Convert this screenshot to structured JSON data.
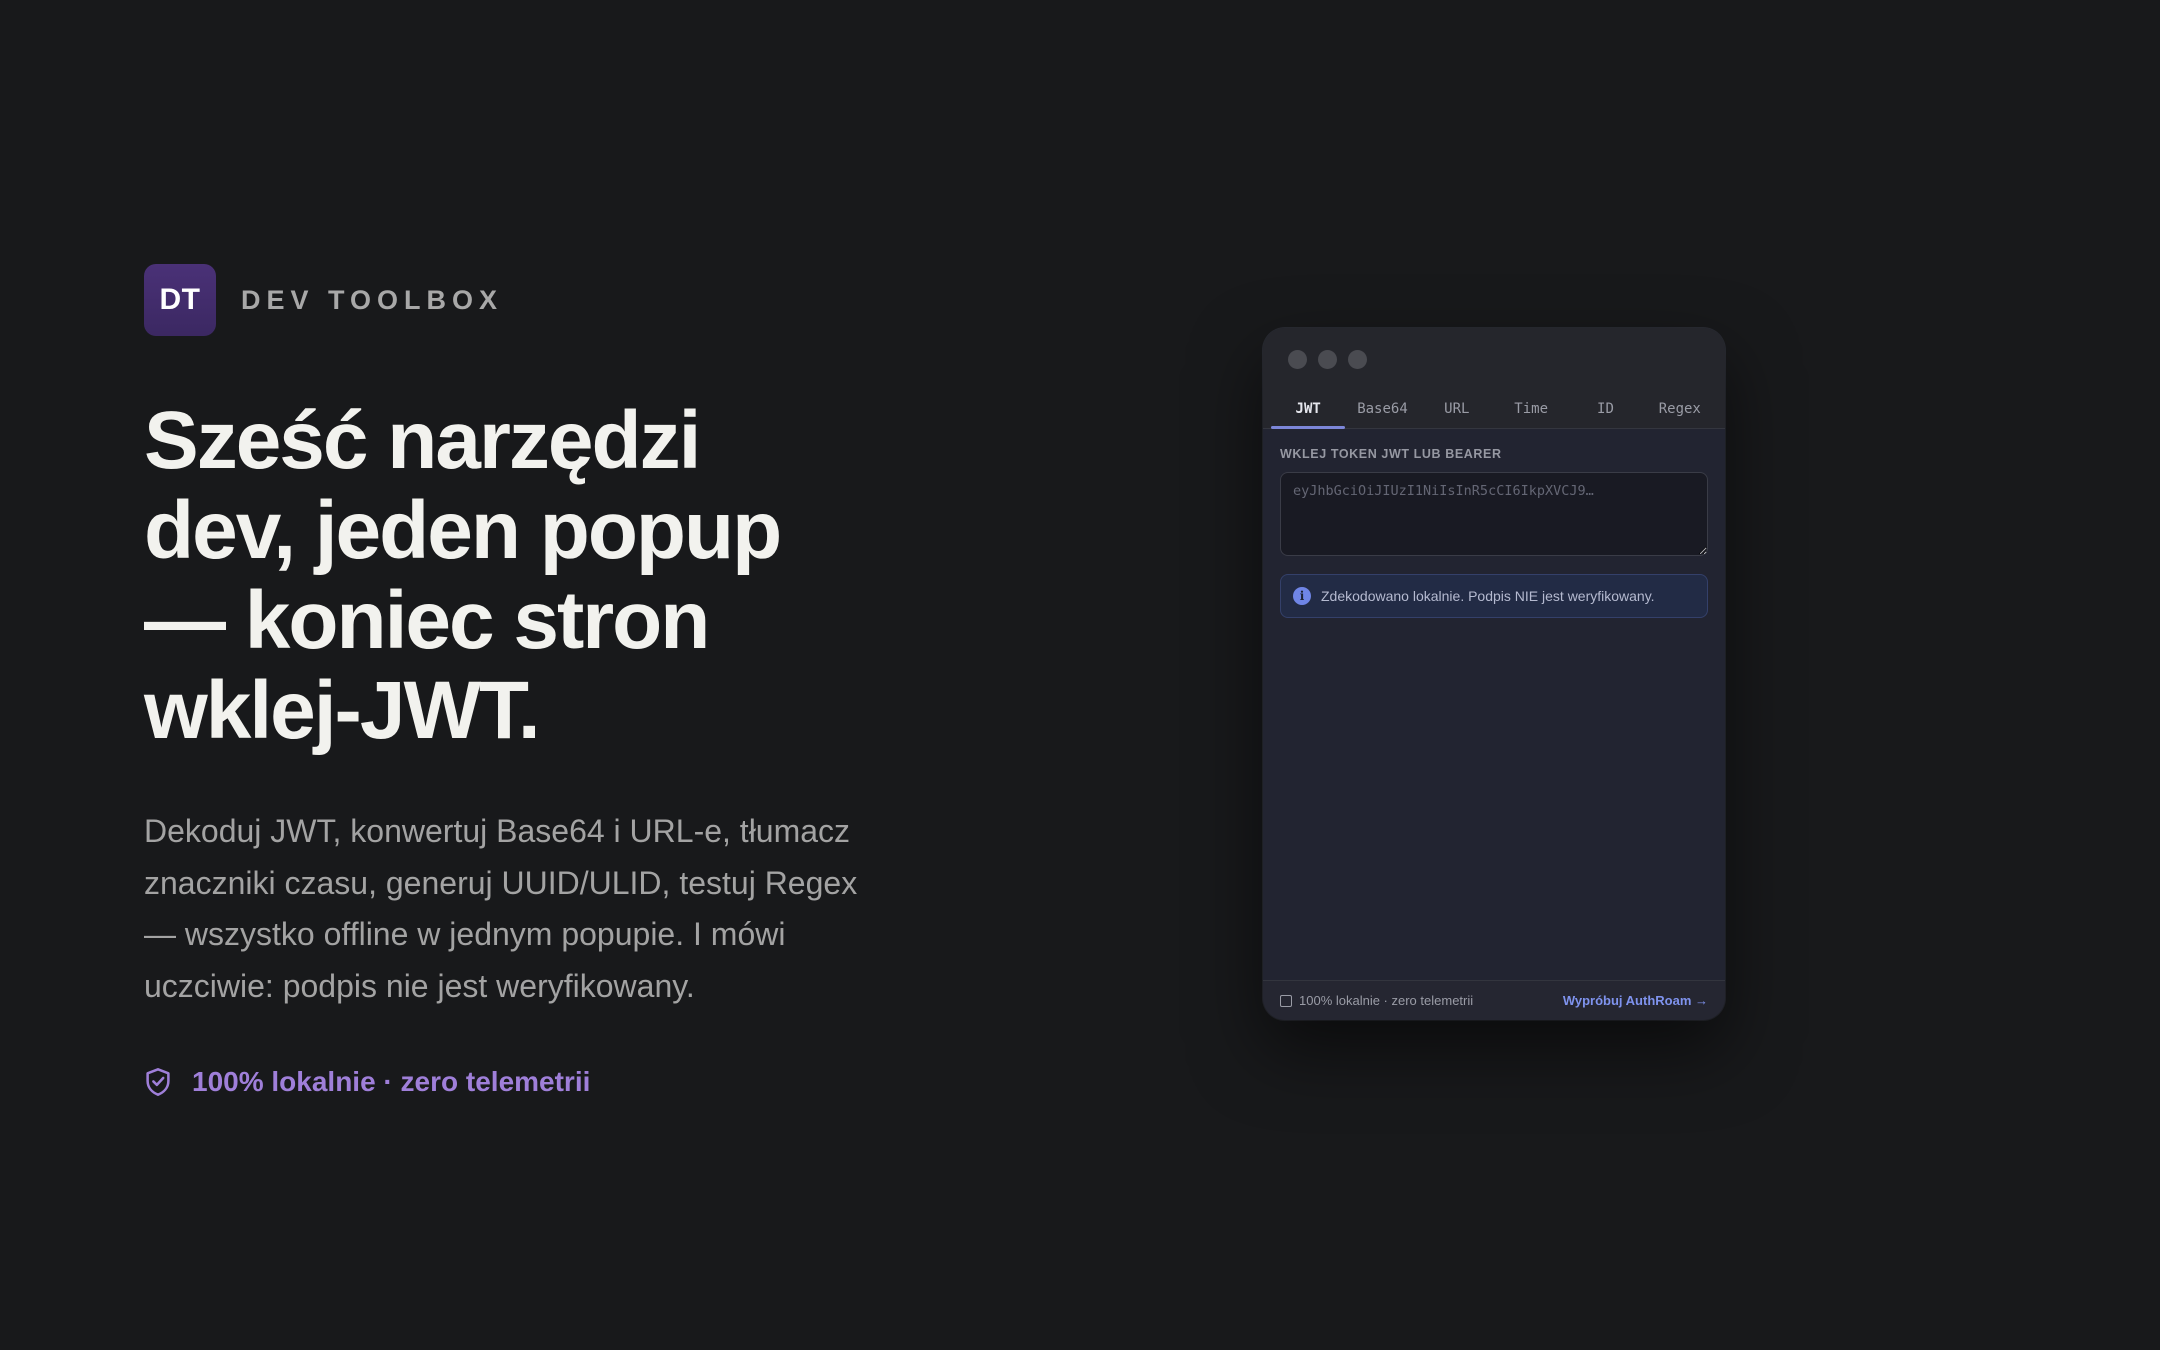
{
  "brand": {
    "logo_text": "DT",
    "name": "DEV TOOLBOX"
  },
  "headline": {
    "lines": [
      "Sześć narzędzi",
      "dev, jeden popup",
      "— koniec stron",
      "wklej-JWT."
    ]
  },
  "subcopy": {
    "lines": [
      "Dekoduj JWT, konwertuj Base64 i URL-e, tłumacz",
      "znaczniki czasu, generuj UUID/ULID, testuj Regex",
      "— wszystko offline w jednym popupie. I mówi",
      "uczciwie: podpis nie jest weryfikowany."
    ]
  },
  "privacy_badge": {
    "icon": "shield-check-icon",
    "text": "100% lokalnie · zero telemetrii"
  },
  "popup": {
    "tabs": [
      {
        "label": "JWT",
        "active": true
      },
      {
        "label": "Base64",
        "active": false
      },
      {
        "label": "URL",
        "active": false
      },
      {
        "label": "Time",
        "active": false
      },
      {
        "label": "ID",
        "active": false
      },
      {
        "label": "Regex",
        "active": false
      }
    ],
    "field_label": "WKLEJ TOKEN JWT LUB BEARER",
    "input_value": "",
    "input_placeholder": "eyJhbGciOiJIUzI1NiIsInR5cCI6IkpXVCJ9…",
    "notice_text": "Zdekodowano lokalnie. Podpis NIE jest weryfikowany.",
    "footer": {
      "checkbox_label": "100% lokalnie · zero telemetrii",
      "link_label": "Wypróbuj AuthRoam →"
    }
  },
  "colors": {
    "background": "#18191b",
    "accent_purple": "#9f7fd9",
    "logo_bg": "#4a3177",
    "tab_active_underline": "#7c86d8",
    "link_blue": "#7f93ee",
    "info_blue": "#6f85e6"
  }
}
